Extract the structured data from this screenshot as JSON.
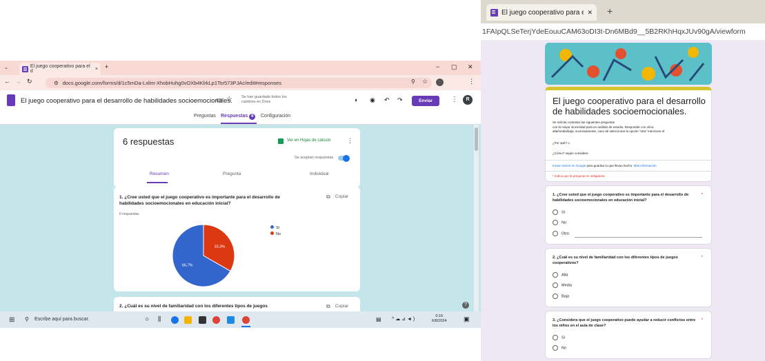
{
  "left_window": {
    "browser_tab_title": "El juego cooperativo para el d",
    "new_tab_symbol": "+",
    "window_controls": [
      "−",
      "▢",
      "✕"
    ],
    "address_bar_url": "docs.google.com/forms/d/1c5mDa-Lxlim-XhobHuhg0vOXb4KlrkLp1Tsr573PJAc/edit#responses",
    "form_title": "El juego cooperativo para el desarrollo de habilidades socioemocionales.",
    "save_status": "Se han guardado todos los cambios en Drive",
    "send_button": "Enviar",
    "avatar_letter": "R",
    "app_tabs": {
      "questions": "Preguntas",
      "responses": "Respuestas",
      "responses_count": "6",
      "settings": "Configuración"
    },
    "summary_card": {
      "title": "6 respuestas",
      "sheets_link": "Ver en Hojas de cálculo",
      "accepting_label": "Se aceptan respuestas",
      "subtabs": [
        "Resumen",
        "Pregunta",
        "Individual"
      ]
    },
    "question1": {
      "text": "1. ¿Cree usted que el juego cooperativo es importante para el desarrollo de habilidades socioemocionales en educación inicial?",
      "responses": "6 respuestas",
      "copy_label": "Copiar"
    },
    "question2": {
      "text": "2. ¿Cuál es su nivel de familiaridad con los diferentes tipos de juegos",
      "copy_label": "Copiar"
    },
    "taskbar": {
      "search_placeholder": "Escribe aquí para buscar.",
      "time": "0:16",
      "date": "6/8/2024"
    }
  },
  "chart_data": {
    "type": "pie",
    "categories": [
      "Sí",
      "No"
    ],
    "values": [
      66.7,
      33.3
    ],
    "labels": [
      "66,7%",
      "33,3%"
    ],
    "colors": [
      "#3366cc",
      "#dc3912"
    ],
    "legend_position": "right"
  },
  "right_window": {
    "browser_tab_title": "El juego cooperativo para el des",
    "close_symbol": "✕",
    "new_tab_symbol": "+",
    "address_bar_url": "1FAIpQLSeTerjYdeEouuCAM63oDI3t-Dn6MBd9__5B2RKhHqxJUv90gA/viewform",
    "form": {
      "title": "El juego cooperativo para el desarrollo de habilidades socioemocionales.",
      "description_1": "Se solicita contestar las siguientes preguntas",
      "description_2": "con la mayor sinceridad para un análisis de estudio. Responder con sí/no,",
      "description_3": "alta/media/baja, sucesivamente, caso de seleccionar la opción \"otra\" mencione el",
      "why": "¿Por qué? o",
      "how": "¿Cómo? según considere.",
      "signin_link": "Iniciar sesión en Google",
      "signin_text": " para guardar lo que llevas hecho. ",
      "more_info": "Más información",
      "required_note": "* Indica que la pregunta es obligatoria"
    },
    "q1": {
      "text": "1.  ¿Cree usted que el juego cooperativo es importante para el desarrollo de habilidades socioemocionales en educación inicial?",
      "options": [
        "Sí",
        "No",
        "Otro:"
      ]
    },
    "q2": {
      "text": "2.  ¿Cuál es su nivel de familiaridad con los diferentes tipos de juegos cooperativos?",
      "options": [
        "Alta",
        "Media",
        "Baja"
      ]
    },
    "q3": {
      "text": "3. ¿Considera que el juego cooperativo puede ayudar a reducir conflictos entre los niños en el aula de clase?",
      "options": [
        "Sí",
        "No"
      ]
    },
    "required_mark": "*"
  }
}
